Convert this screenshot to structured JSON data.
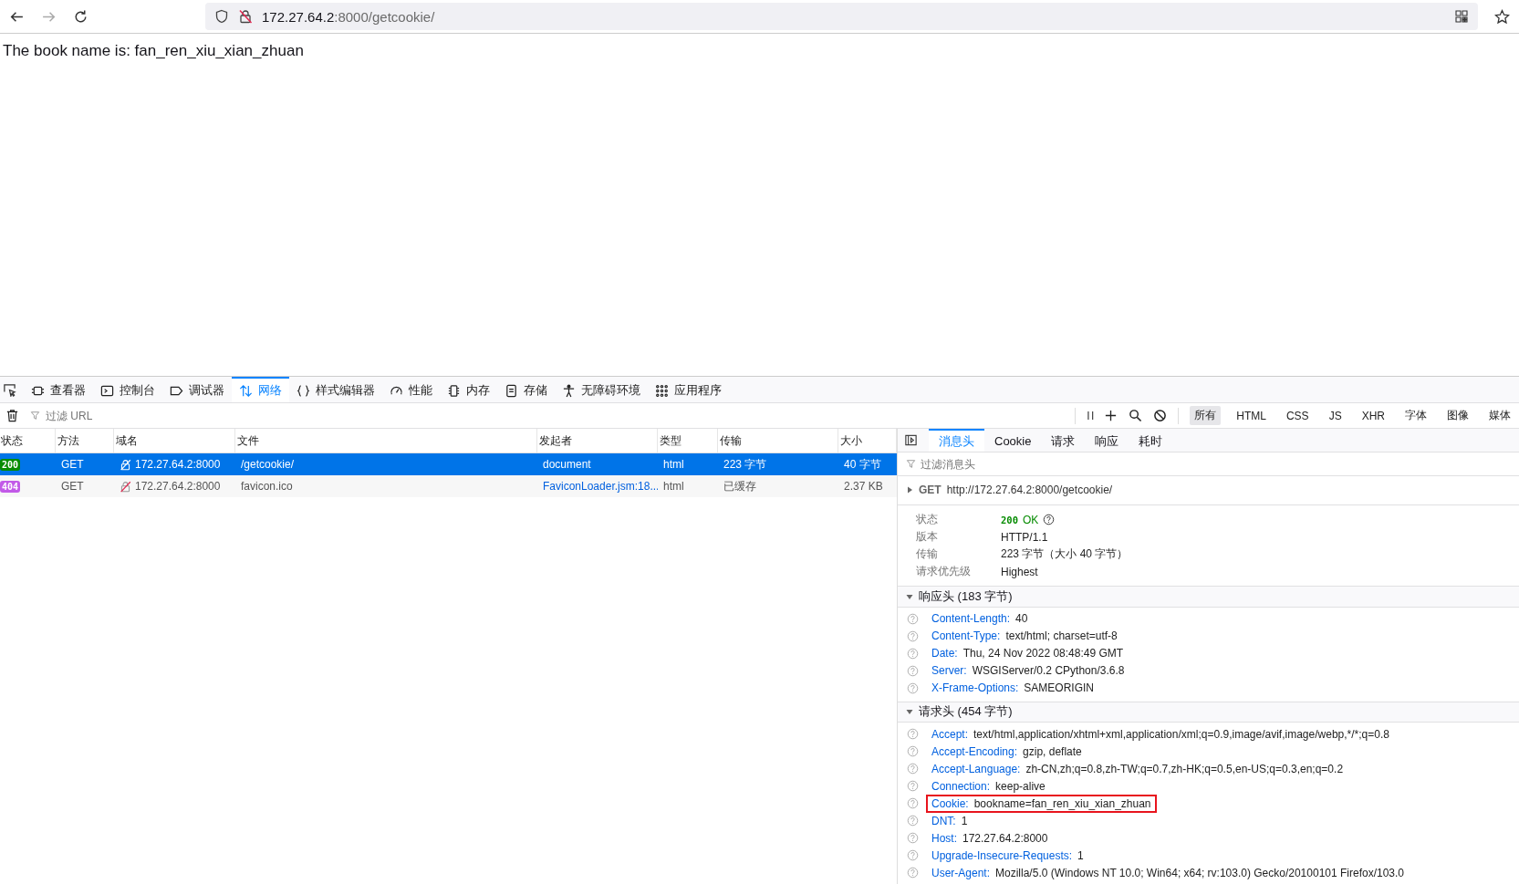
{
  "address_bar": {
    "host": "172.27.64.2",
    "path": ":8000/getcookie/"
  },
  "page": {
    "text": "The book name is: fan_ren_xiu_xian_zhuan"
  },
  "devtools_tabs": [
    {
      "label": "查看器",
      "selected": false
    },
    {
      "label": "控制台",
      "selected": false
    },
    {
      "label": "调试器",
      "selected": false
    },
    {
      "label": "网络",
      "selected": true
    },
    {
      "label": "样式编辑器",
      "selected": false
    },
    {
      "label": "性能",
      "selected": false
    },
    {
      "label": "内存",
      "selected": false
    },
    {
      "label": "存储",
      "selected": false
    },
    {
      "label": "无障碍环境",
      "selected": false
    },
    {
      "label": "应用程序",
      "selected": false
    }
  ],
  "filter": {
    "placeholder": "过滤 URL"
  },
  "pause_label": "I I",
  "type_filters": [
    {
      "label": "所有",
      "selected": true
    },
    {
      "label": "HTML",
      "selected": false
    },
    {
      "label": "CSS",
      "selected": false
    },
    {
      "label": "JS",
      "selected": false
    },
    {
      "label": "XHR",
      "selected": false
    },
    {
      "label": "字体",
      "selected": false
    },
    {
      "label": "图像",
      "selected": false
    },
    {
      "label": "媒体",
      "selected": false
    }
  ],
  "table": {
    "columns": [
      "状态",
      "方法",
      "域名",
      "文件",
      "发起者",
      "类型",
      "传输",
      "大小"
    ],
    "rows": [
      {
        "status": "200",
        "color": "#058b00",
        "method": "GET",
        "domain": "172.27.64.2:8000",
        "file": "/getcookie/",
        "initiator": "document",
        "type": "html",
        "transfer": "223 字节",
        "size": "40 字节",
        "selected": true
      },
      {
        "status": "404",
        "color": "#c25ae8",
        "method": "GET",
        "domain": "172.27.64.2:8000",
        "file": "favicon.ico",
        "initiator": "FaviconLoader.jsm:18...",
        "type": "html",
        "transfer": "已缓存",
        "size": "2.37 KB",
        "selected": false
      }
    ]
  },
  "detail_tabs": [
    {
      "label": "消息头",
      "selected": true
    },
    {
      "label": "Cookie",
      "selected": false
    },
    {
      "label": "请求",
      "selected": false
    },
    {
      "label": "响应",
      "selected": false
    },
    {
      "label": "耗时",
      "selected": false
    }
  ],
  "detail_filter": {
    "placeholder": "过滤消息头"
  },
  "request_line": {
    "method": "GET",
    "url": "http://172.27.64.2:8000/getcookie/"
  },
  "summary": [
    {
      "label": "状态",
      "value": "200",
      "extra": "OK",
      "kind": "status"
    },
    {
      "label": "版本",
      "value": "HTTP/1.1",
      "kind": "text"
    },
    {
      "label": "传输",
      "value": "223 字节（大小 40 字节）",
      "kind": "text"
    },
    {
      "label": "请求优先级",
      "value": "Highest",
      "kind": "text"
    }
  ],
  "sections": [
    {
      "title": "响应头 (183 字节)",
      "expanded": true,
      "headers": [
        {
          "name": "Content-Length:",
          "value": "40",
          "highlighted": false
        },
        {
          "name": "Content-Type:",
          "value": "text/html; charset=utf-8",
          "highlighted": false
        },
        {
          "name": "Date:",
          "value": "Thu, 24 Nov 2022 08:48:49 GMT",
          "highlighted": false
        },
        {
          "name": "Server:",
          "value": "WSGIServer/0.2 CPython/3.6.8",
          "highlighted": false
        },
        {
          "name": "X-Frame-Options:",
          "value": "SAMEORIGIN",
          "highlighted": false
        }
      ]
    },
    {
      "title": "请求头 (454 字节)",
      "expanded": true,
      "headers": [
        {
          "name": "Accept:",
          "value": "text/html,application/xhtml+xml,application/xml;q=0.9,image/avif,image/webp,*/*;q=0.8",
          "highlighted": false
        },
        {
          "name": "Accept-Encoding:",
          "value": "gzip, deflate",
          "highlighted": false
        },
        {
          "name": "Accept-Language:",
          "value": "zh-CN,zh;q=0.8,zh-TW;q=0.7,zh-HK;q=0.5,en-US;q=0.3,en;q=0.2",
          "highlighted": false
        },
        {
          "name": "Connection:",
          "value": "keep-alive",
          "highlighted": false
        },
        {
          "name": "Cookie:",
          "value": "bookname=fan_ren_xiu_xian_zhuan",
          "highlighted": true
        },
        {
          "name": "DNT:",
          "value": "1",
          "highlighted": false
        },
        {
          "name": "Host:",
          "value": "172.27.64.2:8000",
          "highlighted": false
        },
        {
          "name": "Upgrade-Insecure-Requests:",
          "value": "1",
          "highlighted": false
        },
        {
          "name": "User-Agent:",
          "value": "Mozilla/5.0 (Windows NT 10.0; Win64; x64; rv:103.0) Gecko/20100101 Firefox/103.0",
          "highlighted": false
        }
      ]
    }
  ]
}
